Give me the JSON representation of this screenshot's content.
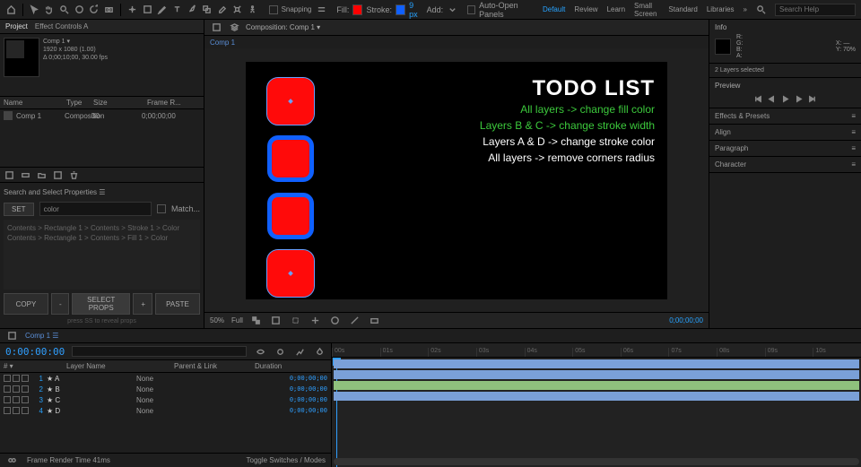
{
  "topbar": {
    "snapping": "Snapping",
    "fill_label": "Fill:",
    "stroke_label": "Stroke:",
    "stroke_width": "9 px",
    "add_label": "Add:",
    "auto_open": "Auto-Open Panels",
    "workspaces": [
      "Default",
      "Review",
      "Learn",
      "Small Screen",
      "Standard",
      "Libraries"
    ],
    "search_placeholder": "Search Help"
  },
  "project": {
    "tab1": "Project",
    "tab2": "Effect Controls A",
    "comp_name": "Comp 1 ▾",
    "comp_res": "1920 x 1080 (1.00)",
    "comp_dur": "Δ 0;00;10;00, 30.00 fps",
    "cols": [
      "Name",
      "Type",
      "Size",
      "Frame R..."
    ],
    "row": {
      "name": "Comp 1",
      "type": "Composition",
      "size": "30",
      "fps": "0;00;00;00"
    }
  },
  "script": {
    "title": "Search and Select Properties ☰",
    "set_btn": "SET",
    "field_value": "color",
    "match_label": "Match...",
    "path1": "Contents > Rectangle 1 > Contents > Stroke 1 > Color",
    "path2": "Contents > Rectangle 1 > Contents > Fill 1 > Color",
    "hint": "press SS to reveal props",
    "copy": "COPY",
    "minus": "-",
    "select": "SELECT PROPS",
    "plus": "+",
    "paste": "PASTE"
  },
  "comp": {
    "tab": "Composition: Comp 1 ▾",
    "crumb": "Comp 1"
  },
  "canvas": {
    "title": "TODO LIST",
    "l1": "All layers -> change fill color",
    "l2": "Layers B & C -> change stroke width",
    "l3": "Layers A & D -> change stroke color",
    "l4": "All layers -> remove corners radius"
  },
  "viewer": {
    "zoom": "50%",
    "mode": "Full",
    "time": "0;00;00;00"
  },
  "info": {
    "title": "Info",
    "rgba": "R:\nG:\nB:\nA:",
    "xy": "X: —\nY: 70%",
    "layers_sel": "2 Layers selected"
  },
  "preview": {
    "title": "Preview"
  },
  "panels": [
    "Effects & Presets",
    "Align",
    "Paragraph",
    "Character"
  ],
  "timeline": {
    "tab": "Comp 1 ☰",
    "timecode": "0:00:00:00",
    "cols": [
      "# ▾",
      "Layer Name",
      "Parent & Link",
      "Duration"
    ],
    "ruler": [
      "00s",
      "01s",
      "02s",
      "03s",
      "04s",
      "05s",
      "06s",
      "07s",
      "08s",
      "09s",
      "10s"
    ],
    "layers": [
      {
        "n": "1",
        "name": "★ A",
        "mode": "None",
        "dur": "0;00;00;00",
        "c": "#7aa0d8"
      },
      {
        "n": "2",
        "name": "★ B",
        "mode": "None",
        "dur": "0;00;00;00",
        "c": "#7aa0d8"
      },
      {
        "n": "3",
        "name": "★ C",
        "mode": "None",
        "dur": "0;00;00;00",
        "c": "#8fc17d"
      },
      {
        "n": "4",
        "name": "★ D",
        "mode": "None",
        "dur": "0;00;00;00",
        "c": "#7aa0d8"
      }
    ],
    "footer_l": "Frame Render Time   41ms",
    "footer_r": "Toggle Switches / Modes"
  }
}
